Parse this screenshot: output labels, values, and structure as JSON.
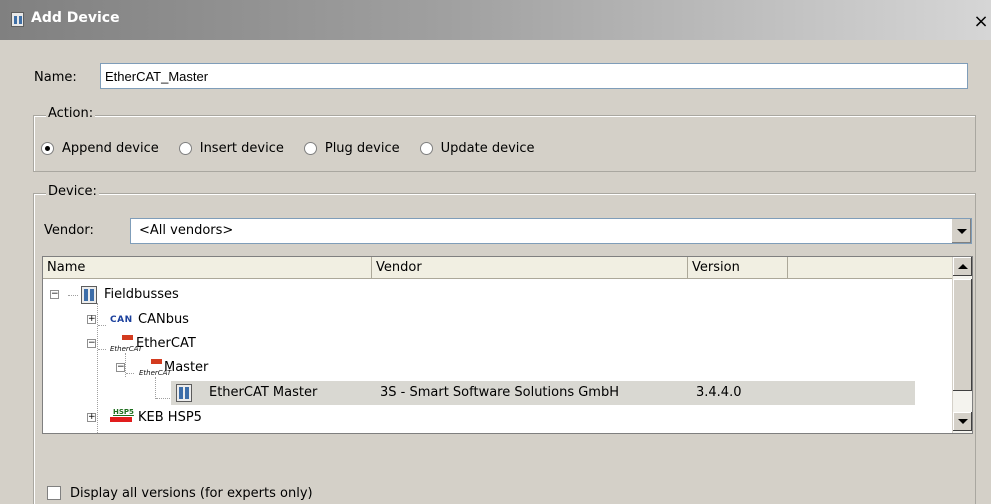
{
  "window": {
    "title": "Add Device",
    "close_label": "×"
  },
  "name_field": {
    "label": "Name:",
    "value": "EtherCAT_Master"
  },
  "action": {
    "label": "Action:",
    "options": [
      {
        "label": "Append device",
        "checked": true
      },
      {
        "label": "Insert device",
        "checked": false
      },
      {
        "label": "Plug device",
        "checked": false
      },
      {
        "label": "Update device",
        "checked": false
      }
    ]
  },
  "device": {
    "label": "Device:",
    "vendor_label": "Vendor:",
    "vendor_value": "<All vendors>",
    "columns": [
      "Name",
      "Vendor",
      "Version"
    ],
    "rows": [
      {
        "name": "Fieldbusses",
        "vendor": "",
        "version": "",
        "icon": "rack-icon"
      },
      {
        "name": "CANbus",
        "vendor": "",
        "version": "",
        "icon": "can-icon"
      },
      {
        "name": "EtherCAT",
        "vendor": "",
        "version": "",
        "icon": "ethercat-icon"
      },
      {
        "name": "Master",
        "vendor": "",
        "version": "",
        "icon": "ethercat-icon"
      },
      {
        "name": "EtherCAT Master",
        "vendor": "3S - Smart Software Solutions GmbH",
        "version": "3.4.4.0",
        "icon": "rack-icon",
        "selected": true
      },
      {
        "name": "KEB HSP5",
        "vendor": "",
        "version": "",
        "icon": "hsp5-icon"
      }
    ]
  },
  "icons": {
    "can_text": "CAN",
    "ethercat_text": "EtherCAT",
    "hsp5_text": "HSP5"
  },
  "display_all_versions": {
    "label": "Display all versions (for experts only)",
    "checked": false
  }
}
